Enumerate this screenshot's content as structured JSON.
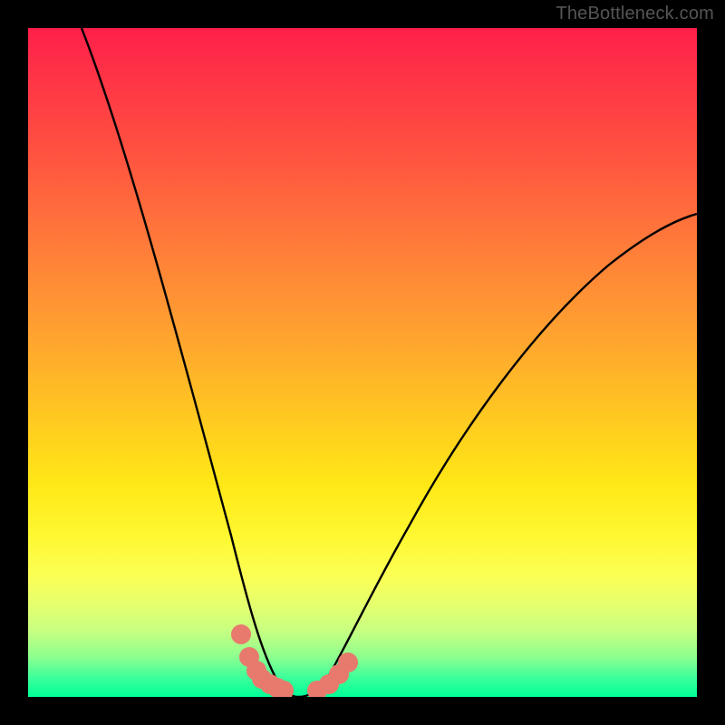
{
  "watermark": "TheBottleneck.com",
  "chart_data": {
    "type": "line",
    "title": "",
    "xlabel": "",
    "ylabel": "",
    "xlim": [
      0,
      100
    ],
    "ylim": [
      0,
      100
    ],
    "grid": false,
    "legend": false,
    "series": [
      {
        "name": "curve-left",
        "x": [
          8,
          12,
          16,
          20,
          24,
          28,
          30,
          32,
          33,
          34,
          35,
          36,
          37,
          38,
          40
        ],
        "y": [
          100,
          87,
          73,
          58,
          42,
          24,
          15,
          8,
          5,
          3,
          1.5,
          0.7,
          0.3,
          0.1,
          0
        ]
      },
      {
        "name": "curve-right",
        "x": [
          40,
          44,
          46,
          48,
          50,
          54,
          58,
          62,
          68,
          74,
          80,
          86,
          92,
          100
        ],
        "y": [
          0,
          0.2,
          1.2,
          3.5,
          7,
          14,
          22,
          29,
          38,
          46,
          53,
          59,
          64,
          71
        ]
      },
      {
        "name": "markers",
        "x": [
          31.8,
          33.0,
          34.2,
          35.0,
          36.2,
          37.3,
          38.2,
          43.2,
          45.0,
          46.4,
          47.8
        ],
        "y": [
          9.3,
          6.0,
          4.0,
          2.8,
          2.0,
          1.4,
          0.9,
          0.9,
          2.0,
          3.4,
          5.2
        ]
      }
    ],
    "gradient": {
      "top_color": "#ff1f4a",
      "mid_color": "#ffe716",
      "bottom_color": "#00ff98"
    }
  }
}
